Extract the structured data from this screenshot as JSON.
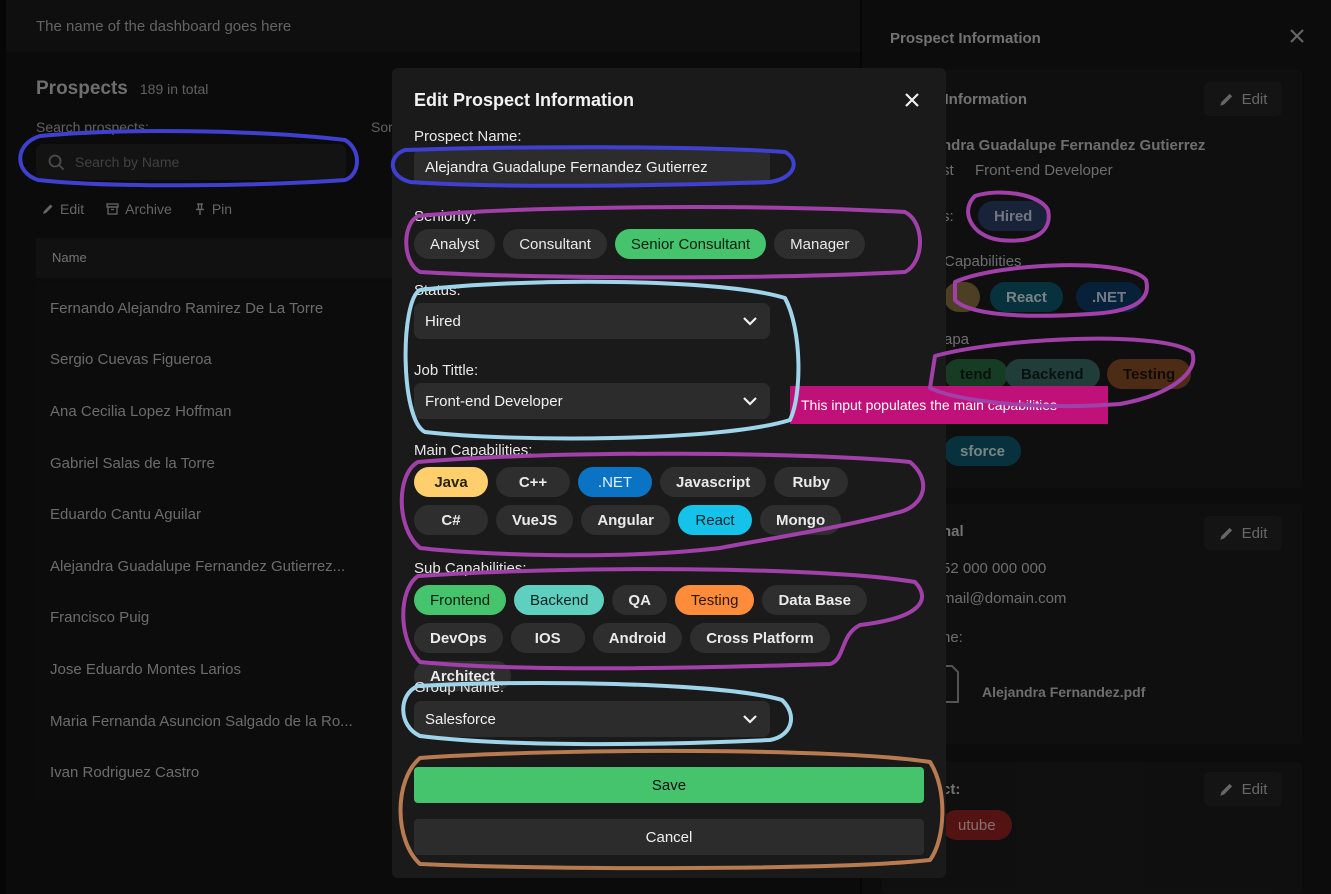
{
  "app": {
    "header_title": "The name  of the dashboard goes here",
    "prospects_title": "Prospects",
    "prospects_count": "189 in total",
    "search_label": "Search prospects:",
    "sort_label": "Sor",
    "search_placeholder": "Search by Name",
    "actions": [
      {
        "label": "Edit",
        "icon": "pencil-icon"
      },
      {
        "label": "Archive",
        "icon": "archive-icon"
      },
      {
        "label": "Pin",
        "icon": "pin-icon"
      }
    ],
    "column_name": "Name",
    "rows": [
      "Fernando Alejandro Ramirez De La Torre",
      "Sergio Cuevas Figueroa",
      "Ana Cecilia Lopez Hoffman",
      "Gabriel Salas de la Torre",
      "Eduardo Cantu Aguilar",
      "Alejandra Guadalupe Fernandez Gutierrez...",
      "Francisco Puig",
      "Jose Eduardo Montes Larios",
      "Maria Fernanda Asuncion Salgado de la Ro...",
      "Ivan Rodriguez Castro"
    ]
  },
  "drawer": {
    "title": "Prospect Information",
    "edit_label": "Edit",
    "section1_title": "e Information",
    "name": "ndra Guadalupe Fernandez Gutierrez",
    "seniority_short": "st",
    "job_title": "Front-end Developer",
    "status_label": "s:",
    "status_value": "Hired",
    "main_cap_label": "Capabilities",
    "main_caps": [
      "",
      "React",
      ".NET"
    ],
    "sub_cap_label": "apa",
    "sub_caps": [
      "tend",
      "Backend",
      "Testing"
    ],
    "group_value": "sforce",
    "section2_title": "nal",
    "phone": "52 000 000 000",
    "email": "mail@domain.com",
    "resume_label": "ne:",
    "resume_file": "Alejandra Fernandez.pdf",
    "section3_title": "ct:",
    "section3_tag": "utube"
  },
  "annotation_tip": "This input populates the main capabilities",
  "modal": {
    "title": "Edit Prospect Information",
    "name_label": "Prospect Name:",
    "name_value": "Alejandra Guadalupe Fernandez Gutierrez",
    "seniority_label": "Seniority:",
    "seniority_options": [
      "Analyst",
      "Consultant",
      "Senior Consultant",
      "Manager"
    ],
    "seniority_selected": "Senior Consultant",
    "status_label": "Status:",
    "status_value": "Hired",
    "job_label": "Job Tittle:",
    "job_value": "Front-end Developer",
    "main_cap_label": "Main Capabilities:",
    "main_caps": [
      "Java",
      "C++",
      ".NET",
      "Javascript",
      "Ruby",
      "C#",
      "VueJS",
      "Angular",
      "React",
      "Mongo"
    ],
    "sub_cap_label": "Sub Capabilities:",
    "sub_caps": [
      "Frontend",
      "Backend",
      "QA",
      "Testing",
      "Data Base",
      "DevOps",
      "IOS",
      "Android",
      "Cross Platform",
      "Architect"
    ],
    "group_label": "Group Name:",
    "group_value": "Salesforce",
    "save_label": "Save",
    "cancel_label": "Cancel"
  },
  "colors": {
    "green": "#45c46d",
    "java": "#ffcf6e",
    "dotnet": "#0b73c4",
    "react": "#14c2ea",
    "backend": "#5fcfbf",
    "testing": "#ff8c3a",
    "annot_blue": "#3f3fd0",
    "annot_purple": "#a040a8",
    "annot_cyan": "#9fd4ea",
    "annot_brown": "#b87a50",
    "annot_magenta": "#c0107a"
  }
}
